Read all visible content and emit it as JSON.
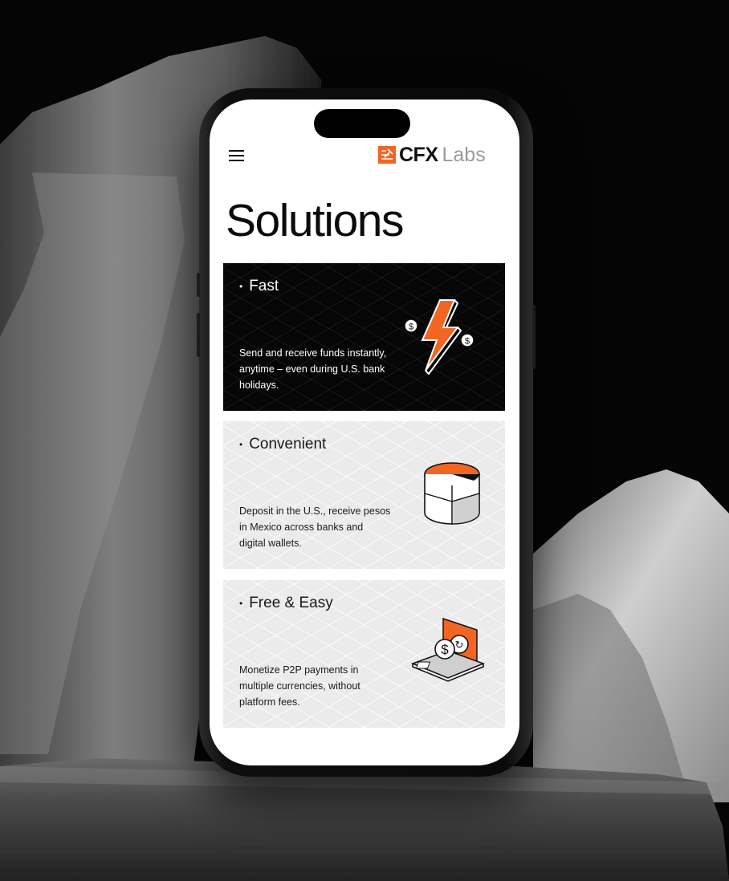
{
  "header": {
    "logo_brand": "CFX",
    "logo_suffix": "Labs"
  },
  "page": {
    "title": "Solutions"
  },
  "cards": [
    {
      "title": "Fast",
      "description": "Send and receive funds instantly, anytime – even during U.S. bank holidays.",
      "icon": "lightning-dollar-icon"
    },
    {
      "title": "Convenient",
      "description": "Deposit in the U.S., receive pesos in Mexico across banks and digital wallets.",
      "icon": "pie-cylinder-icon"
    },
    {
      "title": "Free & Easy",
      "description": "Monetize P2P payments in multiple currencies, without platform fees.",
      "icon": "coin-transfer-icon"
    }
  ],
  "colors": {
    "accent": "#f26522",
    "dark_card": "#060606",
    "light_card": "#ebebeb",
    "logo_suffix": "#9a9a9a"
  }
}
